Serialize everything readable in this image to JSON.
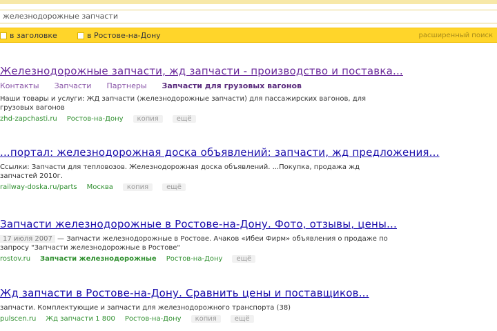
{
  "search": {
    "query": "железнодорожные запчасти"
  },
  "filters": [
    {
      "label": "в заголовке"
    },
    {
      "label": "в Ростове-на-Дону"
    }
  ],
  "filters_right": "расширенный поиск",
  "results": [
    {
      "title": "Железнодорожные запчасти, жд запчасти - производство и поставка...",
      "visited": true,
      "sitelinks": [
        "Контакты",
        "Запчасти",
        "Партнеры",
        "Запчасти для грузовых вагонов"
      ],
      "snippet_1": "Наши товары и услуги: ЖД запчасти (железнодорожные запчасти) для пассажирских вагонов, для",
      "snippet_2": "грузовых вагонов",
      "meta": [
        "zhd-zapchasti.ru",
        "Ростов-на-Дону",
        "копия",
        "ещё"
      ]
    },
    {
      "title": "...портал: железнодорожная доска объявлений: запчасти, жд предложения...",
      "visited": false,
      "snippet_1": "Ссылки: Запчасти для тепловозов. Железнодорожная доска объявлений. ...Покупка, продажа жд",
      "snippet_2": "запчастей 2010г.",
      "meta": [
        "railway-doska.ru/parts",
        "Москва",
        "копия",
        "ещё"
      ]
    },
    {
      "title": "Запчасти железнодорожные в Ростове-на-Дону. Фото, отзывы, цены...",
      "visited": false,
      "date": "17 июля 2007",
      "snippet_1": "— Запчасти железнодорожные в Ростове. Ачаков «Ибеи Фирм» объявления о продаже по",
      "snippet_2": "запросу \"Запчасти железнодорожные в Ростове\"",
      "meta": [
        "rostov.ru",
        "Запчасти железнодорожные",
        "Ростов-на-Дону",
        "ещё"
      ]
    },
    {
      "title": "Жд запчасти в Ростове-на-Дону. Сравнить цены и поставщиков...",
      "visited": false,
      "snippet_1": "запчасти. Комплектующие и запчасти для железнодорожного транспорта (38)",
      "meta": [
        "pulscen.ru",
        "Жд запчасти 1 800",
        "Ростов-на-Дону",
        "копия",
        "ещё"
      ]
    }
  ]
}
